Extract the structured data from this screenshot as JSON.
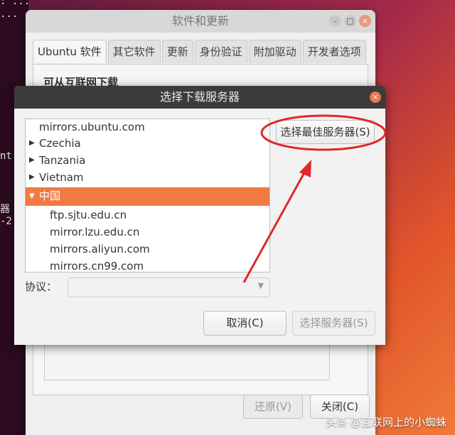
{
  "terminal": {
    "lines": [
      ": ...",
      "...",
      "nt",
      "器",
      "-2"
    ]
  },
  "back_window": {
    "title": "软件和更新",
    "tabs": [
      "Ubuntu 软件",
      "其它软件",
      "更新",
      "身份验证",
      "附加驱动",
      "开发者选项"
    ],
    "section_heading": "可从互联网下载",
    "revert_button": "还原(V)",
    "close_button": "关闭(C)"
  },
  "dialog": {
    "title": "选择下载服务器",
    "best_server_button": "选择最佳服务器(S)",
    "server_tree": [
      {
        "label": "mirrors.ubuntu.com",
        "expandable": false,
        "indent": 0
      },
      {
        "label": "Czechia",
        "expandable": true,
        "expanded": false,
        "indent": 0
      },
      {
        "label": "Tanzania",
        "expandable": true,
        "expanded": false,
        "indent": 0
      },
      {
        "label": "Vietnam",
        "expandable": true,
        "expanded": false,
        "indent": 0
      },
      {
        "label": "中国",
        "expandable": true,
        "expanded": true,
        "indent": 0,
        "selected": true
      },
      {
        "label": "ftp.sjtu.edu.cn",
        "expandable": false,
        "indent": 1
      },
      {
        "label": "mirror.lzu.edu.cn",
        "expandable": false,
        "indent": 1
      },
      {
        "label": "mirrors.aliyun.com",
        "expandable": false,
        "indent": 1
      },
      {
        "label": "mirrors.cn99.com",
        "expandable": false,
        "indent": 1
      }
    ],
    "protocol_label": "协议：",
    "protocol_value": "",
    "cancel_button": "取消(C)",
    "choose_server_button": "选择服务器(S)"
  },
  "annotation": {
    "color": "#e0282a"
  },
  "watermark": "头条 @互联网上的小蜘蛛",
  "colors": {
    "selection": "#f07a42",
    "dialog_titlebar": "#3b3b3b",
    "close_button": "#ec7554"
  }
}
